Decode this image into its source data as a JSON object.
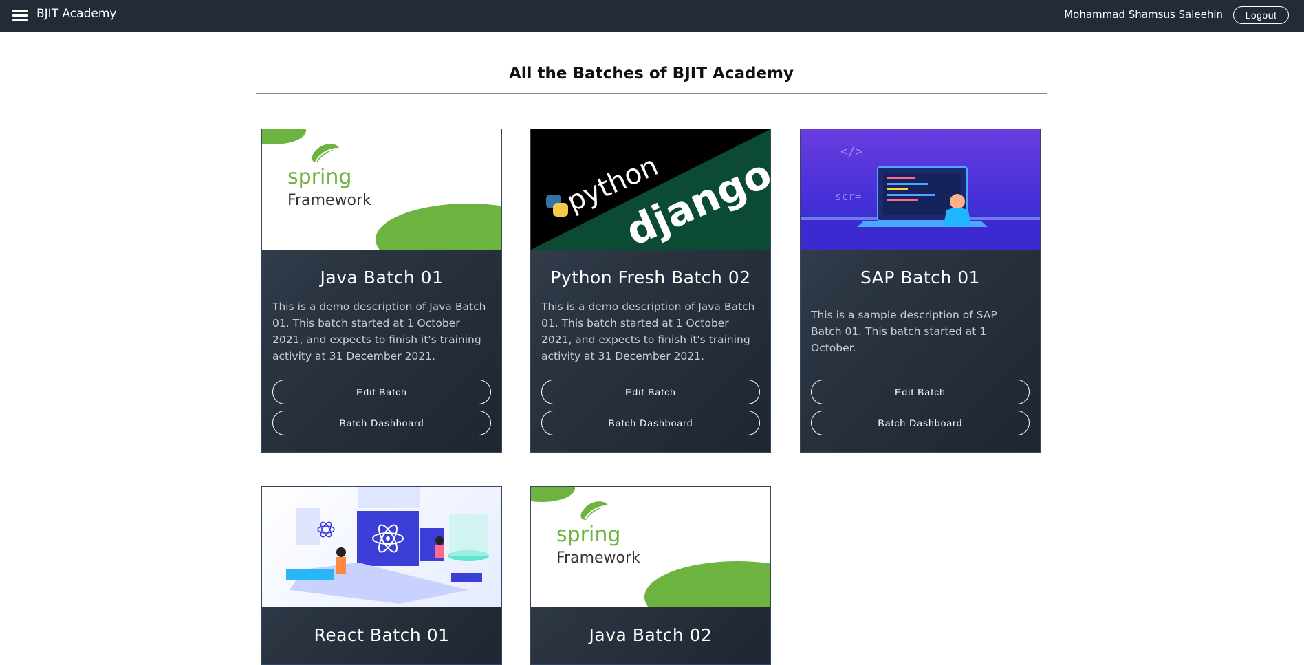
{
  "navbar": {
    "brand": "BJIT Academy",
    "user_name": "Mohammad Shamsus Saleehin",
    "logout_label": "Logout"
  },
  "page": {
    "title": "All the Batches of BJIT Academy"
  },
  "cards": [
    {
      "image": "spring-framework-logo",
      "logo_line1": "spring",
      "logo_line2": "Framework",
      "title": "Java Batch 01",
      "description": "This is a demo description of Java Batch 01. This batch started at 1 October 2021, and expects to finish it's training activity at 31 December 2021.",
      "edit_label": "Edit Batch",
      "dashboard_label": "Batch Dashboard"
    },
    {
      "image": "python-django-logo",
      "logo_line1": "python",
      "logo_line2": "django",
      "title": "Python Fresh Batch 02",
      "description": "This is a demo description of Java Batch 01. This batch started at 1 October 2021, and expects to finish it's training activity at 31 December 2021.",
      "edit_label": "Edit Batch",
      "dashboard_label": "Batch Dashboard"
    },
    {
      "image": "programmer-laptop-illustration",
      "logo_line1": "</>",
      "logo_line2": "scr=",
      "title": "SAP Batch 01",
      "description": "This is a sample description of SAP Batch 01. This batch started at 1 October.",
      "edit_label": "Edit Batch",
      "dashboard_label": "Batch Dashboard"
    },
    {
      "image": "react-team-illustration",
      "title": "React Batch 01"
    },
    {
      "image": "spring-framework-logo",
      "logo_line1": "spring",
      "logo_line2": "Framework",
      "title": "Java Batch 02"
    }
  ],
  "colors": {
    "navbar_bg": "#232b36",
    "card_bg": "#2b3441",
    "spring_green": "#6db33f",
    "django_green": "#0c4b33",
    "sap_purple": "#4b2fd6"
  }
}
